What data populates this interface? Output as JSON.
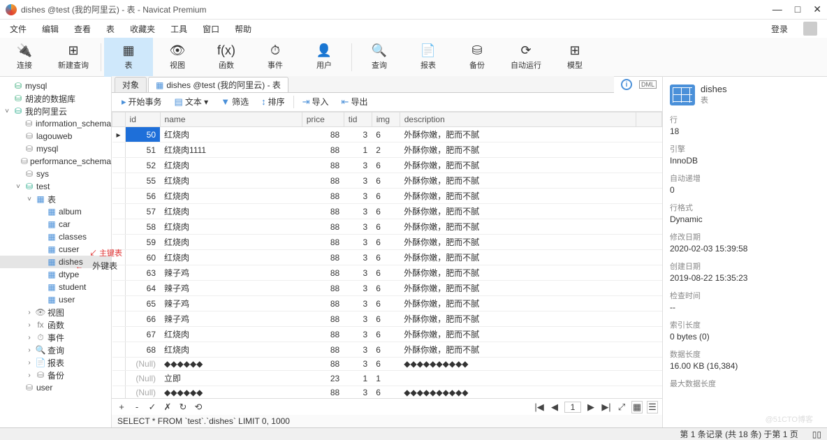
{
  "title": "dishes @test (我的阿里云) - 表 - Navicat Premium",
  "winbtns": {
    "min": "—",
    "max": "□",
    "close": "✕"
  },
  "menu": [
    "文件",
    "编辑",
    "查看",
    "表",
    "收藏夹",
    "工具",
    "窗口",
    "帮助"
  ],
  "login": "登录",
  "toolbar": [
    {
      "icon": "🔌",
      "label": "连接"
    },
    {
      "icon": "⊞",
      "label": "新建查询"
    },
    {
      "sep": true
    },
    {
      "icon": "▦",
      "label": "表",
      "active": true
    },
    {
      "icon": "👁",
      "label": "视图"
    },
    {
      "icon": "f(x)",
      "label": "函数"
    },
    {
      "icon": "⏱",
      "label": "事件"
    },
    {
      "icon": "👤",
      "label": "用户"
    },
    {
      "sep": true
    },
    {
      "icon": "🔍",
      "label": "查询"
    },
    {
      "icon": "📄",
      "label": "报表"
    },
    {
      "icon": "⛁",
      "label": "备份"
    },
    {
      "icon": "⟳",
      "label": "自动运行"
    },
    {
      "icon": "⊞",
      "label": "模型"
    }
  ],
  "tree": [
    {
      "ind": 0,
      "tw": "",
      "icn": "⛁",
      "cls": "srv-icn",
      "label": "mysql"
    },
    {
      "ind": 0,
      "tw": "",
      "icn": "⛁",
      "cls": "srv-icn",
      "label": "胡波的数据库"
    },
    {
      "ind": 0,
      "tw": "˅",
      "icn": "⛁",
      "cls": "db-icn",
      "label": "我的阿里云"
    },
    {
      "ind": 1,
      "tw": "",
      "icn": "⛁",
      "cls": "fld-icn",
      "label": "information_schema"
    },
    {
      "ind": 1,
      "tw": "",
      "icn": "⛁",
      "cls": "fld-icn",
      "label": "lagouweb"
    },
    {
      "ind": 1,
      "tw": "",
      "icn": "⛁",
      "cls": "fld-icn",
      "label": "mysql"
    },
    {
      "ind": 1,
      "tw": "",
      "icn": "⛁",
      "cls": "fld-icn",
      "label": "performance_schema"
    },
    {
      "ind": 1,
      "tw": "",
      "icn": "⛁",
      "cls": "fld-icn",
      "label": "sys"
    },
    {
      "ind": 1,
      "tw": "˅",
      "icn": "⛁",
      "cls": "db-icn",
      "label": "test"
    },
    {
      "ind": 2,
      "tw": "˅",
      "icn": "▦",
      "cls": "tbl-icn",
      "label": "表"
    },
    {
      "ind": 3,
      "tw": "",
      "icn": "▦",
      "cls": "tbl-icn",
      "label": "album"
    },
    {
      "ind": 3,
      "tw": "",
      "icn": "▦",
      "cls": "tbl-icn",
      "label": "car"
    },
    {
      "ind": 3,
      "tw": "",
      "icn": "▦",
      "cls": "tbl-icn",
      "label": "classes"
    },
    {
      "ind": 3,
      "tw": "",
      "icn": "▦",
      "cls": "tbl-icn",
      "label": "cuser"
    },
    {
      "ind": 3,
      "tw": "",
      "icn": "▦",
      "cls": "tbl-icn",
      "label": "dishes",
      "sel": true
    },
    {
      "ind": 3,
      "tw": "",
      "icn": "▦",
      "cls": "tbl-icn",
      "label": "dtype"
    },
    {
      "ind": 3,
      "tw": "",
      "icn": "▦",
      "cls": "tbl-icn",
      "label": "student"
    },
    {
      "ind": 3,
      "tw": "",
      "icn": "▦",
      "cls": "tbl-icn",
      "label": "user"
    },
    {
      "ind": 2,
      "tw": "›",
      "icn": "👁",
      "cls": "fld-icn",
      "label": "视图"
    },
    {
      "ind": 2,
      "tw": "›",
      "icn": "fx",
      "cls": "fld-icn",
      "label": "函数"
    },
    {
      "ind": 2,
      "tw": "›",
      "icn": "⏱",
      "cls": "fld-icn",
      "label": "事件"
    },
    {
      "ind": 2,
      "tw": "›",
      "icn": "🔍",
      "cls": "fld-icn",
      "label": "查询"
    },
    {
      "ind": 2,
      "tw": "›",
      "icn": "📄",
      "cls": "fld-icn",
      "label": "报表"
    },
    {
      "ind": 2,
      "tw": "›",
      "icn": "⛁",
      "cls": "fld-icn",
      "label": "备份"
    },
    {
      "ind": 1,
      "tw": "",
      "icn": "⛁",
      "cls": "fld-icn",
      "label": "user"
    }
  ],
  "anno1": "主键表",
  "anno2": "外键表",
  "tabs": [
    {
      "label": "对象",
      "inactive": true
    },
    {
      "label": "dishes @test (我的阿里云) - 表",
      "icon": "▦"
    }
  ],
  "subbar": [
    {
      "icon": "▸",
      "label": "开始事务"
    },
    {
      "icon": "▤",
      "label": "文本 ▾"
    },
    {
      "icon": "▼",
      "label": "筛选",
      "color": "#4a90d9"
    },
    {
      "icon": "↕",
      "label": "排序"
    },
    {
      "sep": true
    },
    {
      "icon": "⇥",
      "label": "导入"
    },
    {
      "icon": "⇤",
      "label": "导出"
    }
  ],
  "cols": [
    "id",
    "name",
    "price",
    "tid",
    "img",
    "description"
  ],
  "rows": [
    {
      "sel": true,
      "id": 50,
      "name": "红烧肉",
      "price": 88,
      "tid": 3,
      "img": "6",
      "desc": "外酥你嫩，肥而不腻"
    },
    {
      "id": 51,
      "name": "红烧肉1111",
      "price": 88,
      "tid": 1,
      "img": "2",
      "desc": "外酥你嫩，肥而不腻"
    },
    {
      "id": 52,
      "name": "红烧肉",
      "price": 88,
      "tid": 3,
      "img": "6",
      "desc": "外酥你嫩，肥而不腻"
    },
    {
      "id": 55,
      "name": "红烧肉",
      "price": 88,
      "tid": 3,
      "img": "6",
      "desc": "外酥你嫩，肥而不腻"
    },
    {
      "id": 56,
      "name": "红烧肉",
      "price": 88,
      "tid": 3,
      "img": "6",
      "desc": "外酥你嫩，肥而不腻"
    },
    {
      "id": 57,
      "name": "红烧肉",
      "price": 88,
      "tid": 3,
      "img": "6",
      "desc": "外酥你嫩，肥而不腻"
    },
    {
      "id": 58,
      "name": "红烧肉",
      "price": 88,
      "tid": 3,
      "img": "6",
      "desc": "外酥你嫩，肥而不腻"
    },
    {
      "id": 59,
      "name": "红烧肉",
      "price": 88,
      "tid": 3,
      "img": "6",
      "desc": "外酥你嫩，肥而不腻"
    },
    {
      "id": 60,
      "name": "红烧肉",
      "price": 88,
      "tid": 3,
      "img": "6",
      "desc": "外酥你嫩，肥而不腻"
    },
    {
      "id": 63,
      "name": "辣子鸡",
      "price": 88,
      "tid": 3,
      "img": "6",
      "desc": "外酥你嫩，肥而不腻"
    },
    {
      "id": 64,
      "name": "辣子鸡",
      "price": 88,
      "tid": 3,
      "img": "6",
      "desc": "外酥你嫩，肥而不腻"
    },
    {
      "id": 65,
      "name": "辣子鸡",
      "price": 88,
      "tid": 3,
      "img": "6",
      "desc": "外酥你嫩，肥而不腻"
    },
    {
      "id": 66,
      "name": "辣子鸡",
      "price": 88,
      "tid": 3,
      "img": "6",
      "desc": "外酥你嫩，肥而不腻"
    },
    {
      "id": 67,
      "name": "红烧肉",
      "price": 88,
      "tid": 3,
      "img": "6",
      "desc": "外酥你嫩，肥而不腻"
    },
    {
      "id": 68,
      "name": "红烧肉",
      "price": 88,
      "tid": 3,
      "img": "6",
      "desc": "外酥你嫩，肥而不腻"
    },
    {
      "id": null,
      "name": "◆◆◆◆◆◆",
      "price": 88,
      "tid": 3,
      "img": "6",
      "desc": "◆◆◆◆◆◆◆◆◆◆"
    },
    {
      "id": null,
      "name": "立即",
      "price": 23,
      "tid": 1,
      "img": "1",
      "desc": ""
    },
    {
      "id": null,
      "name": "◆◆◆◆◆◆",
      "price": 88,
      "tid": 3,
      "img": "6",
      "desc": "◆◆◆◆◆◆◆◆◆◆"
    }
  ],
  "footbtns_l": [
    "+",
    "-",
    "✓",
    "✗",
    "↻",
    "⟲"
  ],
  "footbtns_r": [
    "|◀",
    "◀",
    "",
    "▶",
    "▶|",
    "⤢"
  ],
  "pagenum": "1",
  "view_btns": [
    "▦",
    "☰"
  ],
  "sql": "SELECT * FROM `test`.`dishes` LIMIT 0, 1000",
  "status": "第 1 条记录 (共 18 条) 于第 1 页",
  "props": {
    "name": "dishes",
    "sub": "表",
    "items": [
      {
        "l": "行",
        "v": "18"
      },
      {
        "l": "引擎",
        "v": "InnoDB"
      },
      {
        "l": "自动递增",
        "v": "0"
      },
      {
        "l": "行格式",
        "v": "Dynamic"
      },
      {
        "l": "修改日期",
        "v": "2020-02-03 15:39:58"
      },
      {
        "l": "创建日期",
        "v": "2019-08-22 15:35:23"
      },
      {
        "l": "检查时间",
        "v": "--"
      },
      {
        "l": "索引长度",
        "v": "0 bytes (0)"
      },
      {
        "l": "数据长度",
        "v": "16.00 KB (16,384)"
      },
      {
        "l": "最大数据长度",
        "v": ""
      }
    ]
  },
  "watermark": "@51CTO博客"
}
